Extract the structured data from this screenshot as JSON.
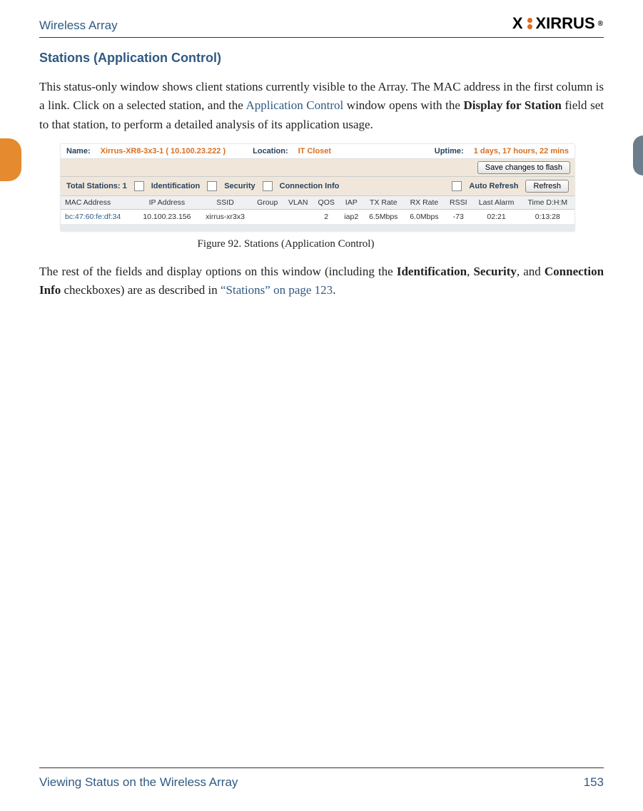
{
  "header": {
    "title": "Wireless Array",
    "logo_text": "XIRRUS",
    "logo_reg": "®"
  },
  "section": {
    "heading": "Stations (Application Control)",
    "para1a": "This status-only window shows client stations currently visible to the Array. The MAC address in the first column is a link. Click on a selected station, and the ",
    "para1_link": "Application Control",
    "para1b": " window opens with the ",
    "para1_bold": "Display for Station",
    "para1c": " field set to that station, to perform a detailed analysis of its application usage.",
    "para2a": "The rest of the fields and display options on this window (including the ",
    "para2_b1": "Identification",
    "para2_sep1": ", ",
    "para2_b2": "Security",
    "para2_sep2": ", and ",
    "para2_b3": "Connection Info",
    "para2b": " checkboxes) are as described in ",
    "para2_link": "“Stations” on page 123",
    "para2c": "."
  },
  "figure": {
    "caption": "Figure 92. Stations (Application Control)",
    "info": {
      "name_lbl": "Name:",
      "name_val": "Xirrus-XR8-3x3-1   ( 10.100.23.222 )",
      "loc_lbl": "Location:",
      "loc_val": "IT Closet",
      "uptime_lbl": "Uptime:",
      "uptime_val": "1 days, 17 hours, 22 mins"
    },
    "save_btn": "Save changes to flash",
    "filters": {
      "total": "Total Stations: 1",
      "ident": "Identification",
      "sec": "Security",
      "conn": "Connection Info",
      "auto": "Auto Refresh",
      "refresh_btn": "Refresh"
    },
    "columns": {
      "mac": "MAC Address",
      "ip": "IP Address",
      "ssid": "SSID",
      "group": "Group",
      "vlan": "VLAN",
      "qos": "QOS",
      "iap": "IAP",
      "tx": "TX Rate",
      "rx": "RX Rate",
      "rssi": "RSSI",
      "alarm": "Last Alarm",
      "time": "Time D:H:M"
    },
    "row": {
      "mac": "bc:47:60:fe:df:34",
      "ip": "10.100.23.156",
      "ssid": "xirrus-xr3x3",
      "group": "",
      "vlan": "",
      "qos": "2",
      "iap": "iap2",
      "tx": "6.5Mbps",
      "rx": "6.0Mbps",
      "rssi": "-73",
      "alarm": "02:21",
      "time": "0:13:28"
    }
  },
  "footer": {
    "left": "Viewing Status on the Wireless Array",
    "right": "153"
  }
}
